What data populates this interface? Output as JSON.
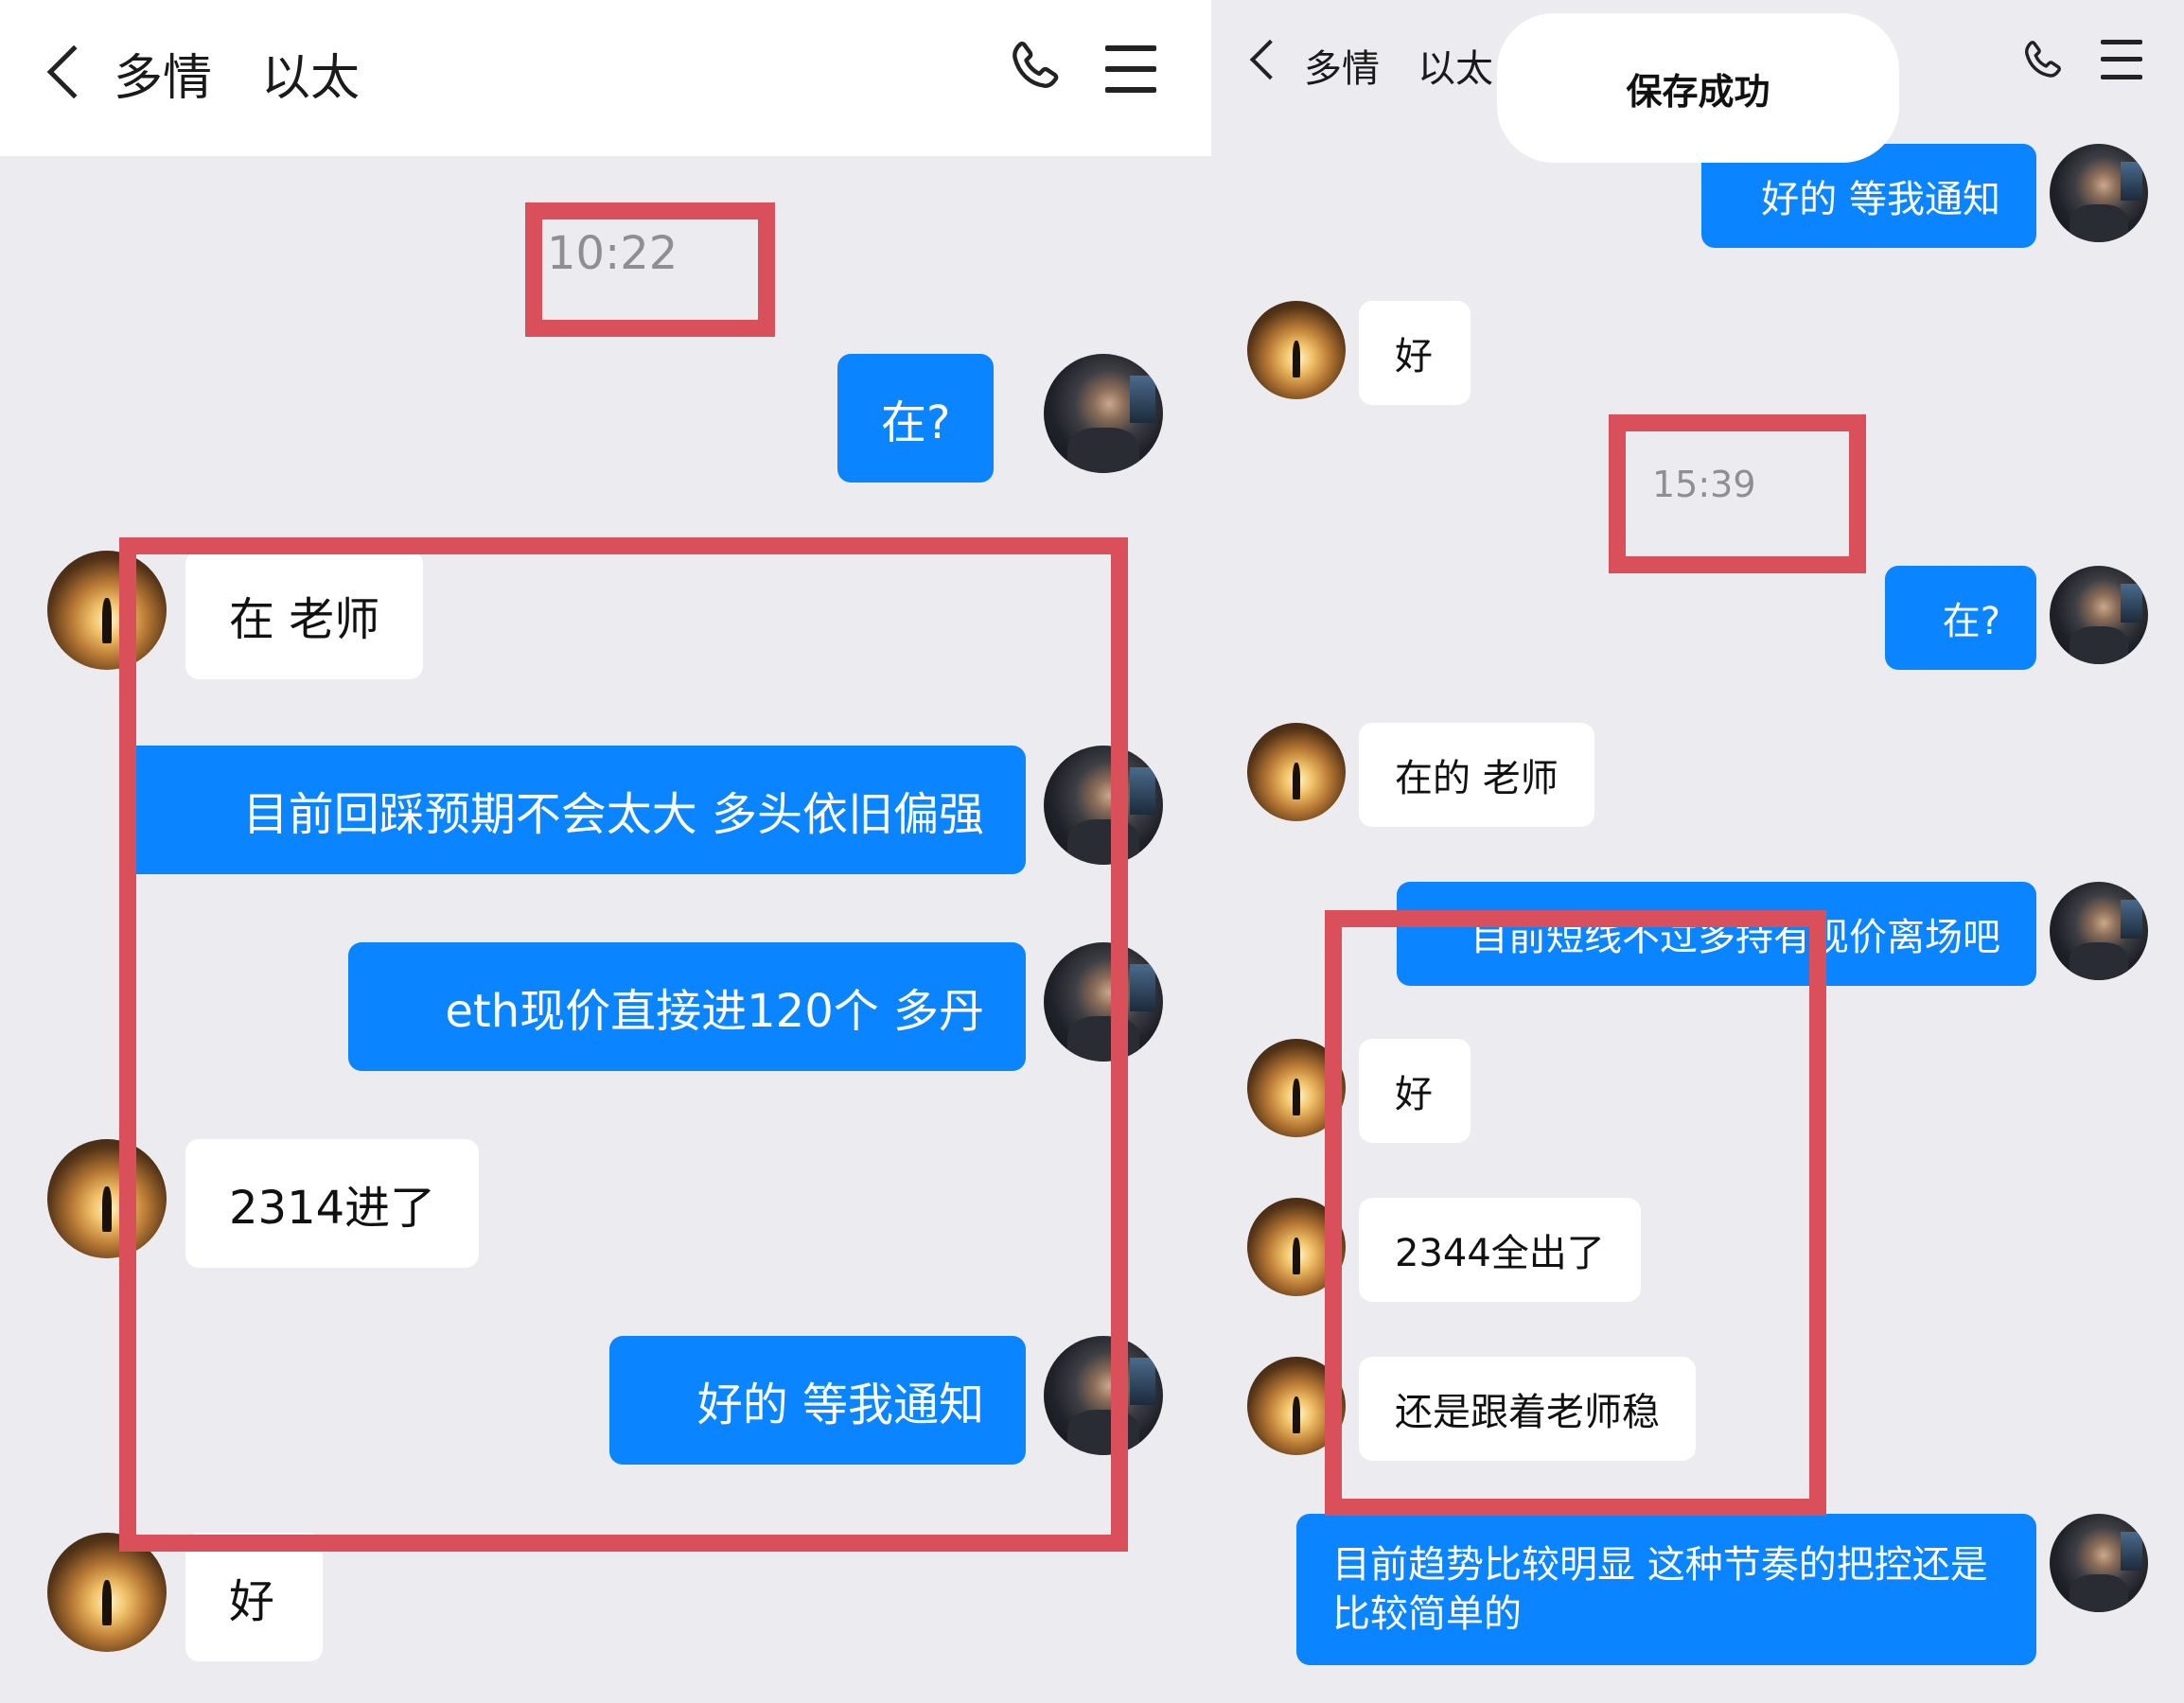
{
  "left": {
    "header": {
      "title": "多情　以太"
    },
    "timestamp": "10:22",
    "messages": [
      "在?",
      "在 老师",
      "目前回踩预期不会太大 多头依旧偏强",
      "eth现价直接进120个  多丹",
      "2314进了",
      "好的  等我通知",
      "好"
    ]
  },
  "right": {
    "header": {
      "title": "多情　以太"
    },
    "toast": "保存成功",
    "timestamp": "15:39",
    "messages": [
      "好的  等我通知",
      "好",
      "在?",
      "在的  老师",
      "目前短线不过多持有现价离场吧",
      "好",
      "2344全出了",
      "还是跟着老师稳",
      "目前趋势比较明显 这种节奏的把控还是比较简单的"
    ]
  },
  "colors": {
    "accent": "#0a84ff",
    "background": "#ecebf0",
    "highlight_box": "#d9505b"
  },
  "icons": [
    "back-icon",
    "phone-icon",
    "menu-icon"
  ]
}
